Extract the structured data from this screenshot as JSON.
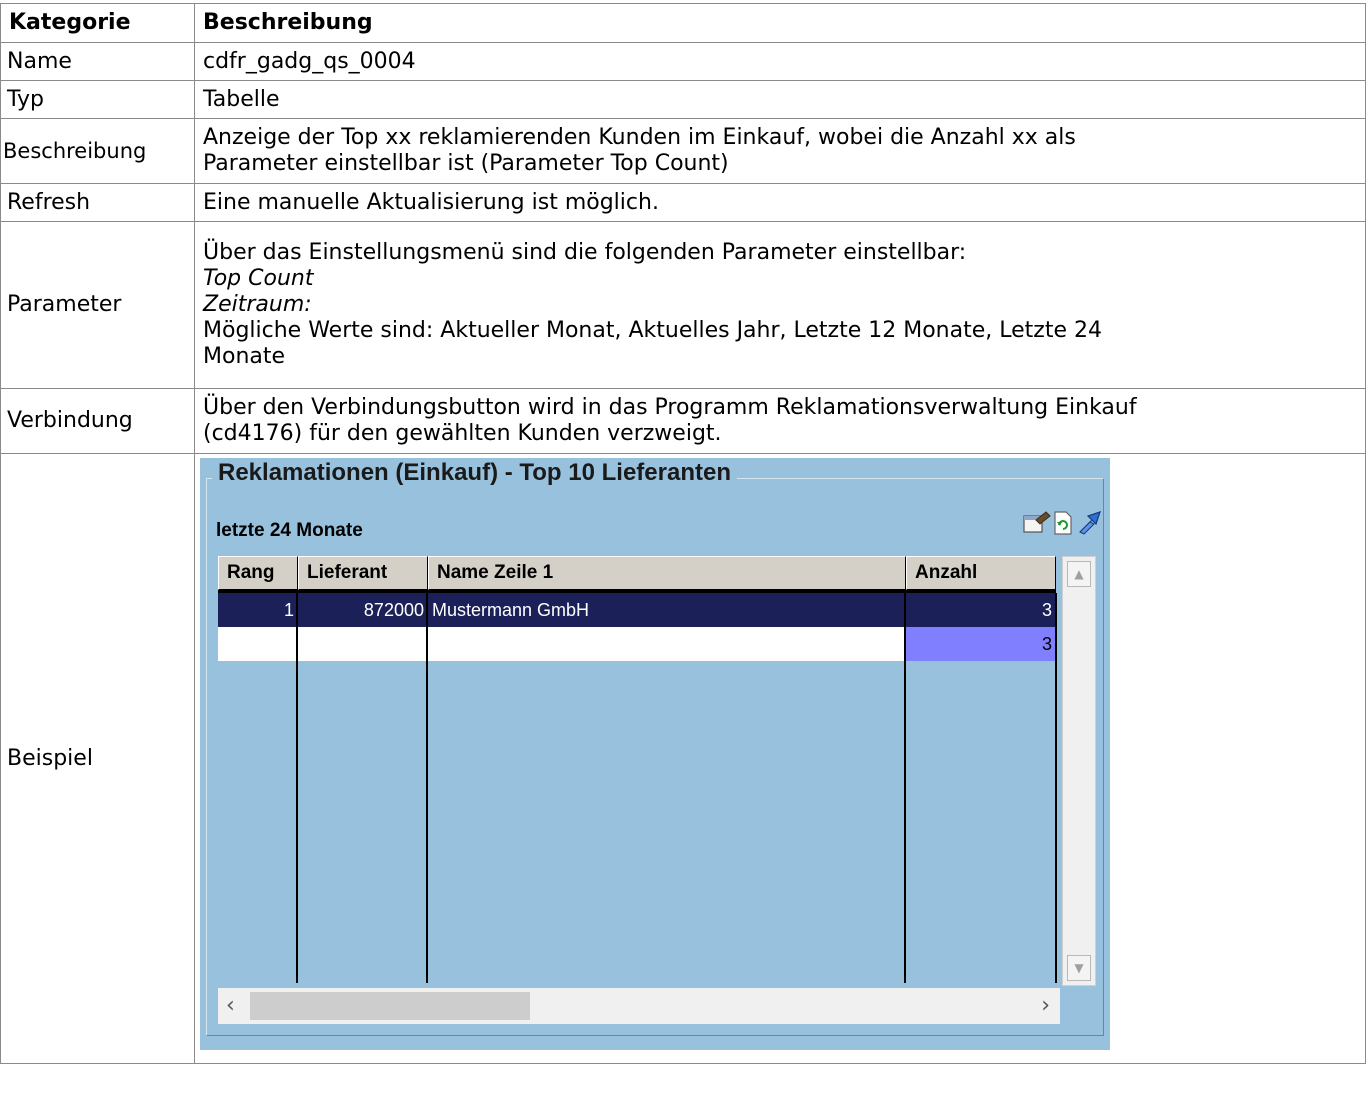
{
  "header": {
    "col1": "Kategorie",
    "col2": "Beschreibung"
  },
  "rows": {
    "name": {
      "label": "Name",
      "value": "cdfr_gadg_qs_0004"
    },
    "typ": {
      "label": "Typ",
      "value": "Tabelle"
    },
    "beschreibung": {
      "label": "Beschreibung",
      "line1": "Anzeige der Top xx reklamierenden Kunden im Einkauf, wobei die Anzahl xx als",
      "line2": "Parameter einstellbar ist (Parameter Top Count)"
    },
    "refresh": {
      "label": "Refresh",
      "value": "Eine manuelle Aktualisierung ist möglich."
    },
    "parameter": {
      "label": "Parameter",
      "line1": "Über das Einstellungsmenü sind die folgenden Parameter einstellbar:",
      "line2": "Top Count",
      "line3": "Zeitraum:",
      "line4": "Mögliche Werte sind: Aktueller Monat, Aktuelles Jahr, Letzte 12 Monate, Letzte 24",
      "line5": "Monate"
    },
    "verbindung": {
      "label": "Verbindung",
      "line1": "Über den Verbindungsbutton wird in das Programm Reklamationsverwaltung Einkauf",
      "line2": "(cd4176) für den gewählten Kunden verzweigt."
    },
    "beispiel": {
      "label": "Beispiel"
    }
  },
  "widget": {
    "title": "Reklamationen (Einkauf) - Top 10 Lieferanten",
    "subtitle": "letzte 24 Monate",
    "icons": [
      "settings-icon",
      "refresh-icon",
      "link-arrow-icon"
    ],
    "columns": [
      "Rang",
      "Lieferant",
      "Name Zeile 1",
      "Anzahl"
    ],
    "data_rows": [
      {
        "rang": "1",
        "lieferant": "872000",
        "name": "Mustermann GmbH",
        "anzahl": "3"
      }
    ],
    "total": "3",
    "colors": {
      "background": "#97c1dd",
      "selected_row": "#1c2058",
      "total_cell": "#7f7fff"
    }
  }
}
